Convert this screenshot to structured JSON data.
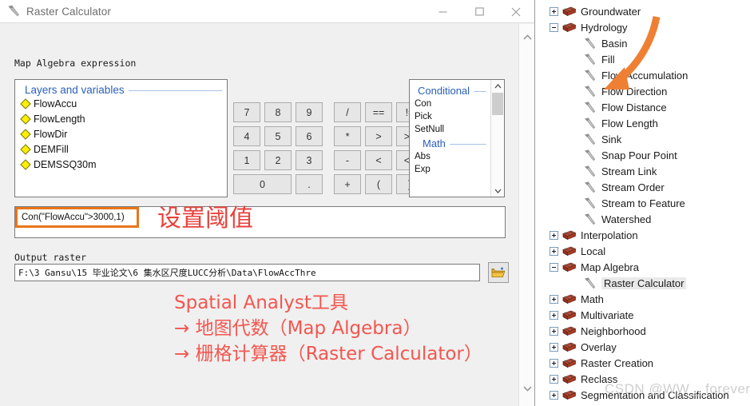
{
  "dialog": {
    "title": "Raster Calculator",
    "title_icon": "hammer-tool-icon",
    "window_buttons": {
      "minimize": "minimize-icon",
      "maximize": "maximize-icon",
      "close": "close-icon"
    },
    "expression_label": "Map Algebra expression",
    "layers_group": {
      "header": "Layers and variables",
      "items": [
        {
          "name": "FlowAccu",
          "icon": "raster-layer-diamond-icon"
        },
        {
          "name": "FlowLength",
          "icon": "raster-layer-diamond-icon"
        },
        {
          "name": "FlowDir",
          "icon": "raster-layer-diamond-icon"
        },
        {
          "name": "DEMFill",
          "icon": "raster-layer-diamond-icon"
        },
        {
          "name": "DEMSSQ30m",
          "icon": "raster-layer-diamond-icon"
        }
      ]
    },
    "keypad": {
      "rows": [
        [
          "7",
          "8",
          "9",
          "/",
          "==",
          "!=",
          "&"
        ],
        [
          "4",
          "5",
          "6",
          "*",
          ">",
          ">=",
          "|"
        ],
        [
          "1",
          "2",
          "3",
          "-",
          "<",
          "<=",
          "^"
        ],
        [
          "0",
          ".",
          "+",
          "(",
          ")",
          "~"
        ]
      ]
    },
    "functions": {
      "conditional_header": "Conditional",
      "conditional_items": [
        "Con",
        "Pick",
        "SetNull"
      ],
      "math_header": "Math",
      "math_items": [
        "Abs",
        "Exp"
      ]
    },
    "expression_value": "Con(\"FlowAccu\">3000,1)",
    "output_label": "Output raster",
    "output_value": "F:\\3 Gansu\\15 毕业论文\\6 集水区尺度LUCC分析\\Data\\FlowAccThre",
    "browse_icon": "open-folder-icon"
  },
  "annotations": {
    "threshold_note": "设置阈值",
    "highlight_color": "#e8761b",
    "note_color": "#f3564f",
    "arrow_color": "#ef8033",
    "path_lines": [
      "Spatial Analyst工具",
      "→ 地图代数（Map Algebra）",
      "→ 栅格计算器（Raster Calculator）"
    ]
  },
  "toolbox_tree": {
    "nodes": [
      {
        "label": "Groundwater",
        "type": "toolbox",
        "state": "collapsed",
        "indent": 0,
        "selected": false
      },
      {
        "label": "Hydrology",
        "type": "toolbox",
        "state": "expanded",
        "indent": 0,
        "selected": false
      },
      {
        "label": "Basin",
        "type": "tool",
        "state": "leaf",
        "indent": 1,
        "selected": false
      },
      {
        "label": "Fill",
        "type": "tool",
        "state": "leaf",
        "indent": 1,
        "selected": false
      },
      {
        "label": "Flow Accumulation",
        "type": "tool",
        "state": "leaf",
        "indent": 1,
        "selected": false
      },
      {
        "label": "Flow Direction",
        "type": "tool",
        "state": "leaf",
        "indent": 1,
        "selected": false
      },
      {
        "label": "Flow Distance",
        "type": "tool",
        "state": "leaf",
        "indent": 1,
        "selected": false
      },
      {
        "label": "Flow Length",
        "type": "tool",
        "state": "leaf",
        "indent": 1,
        "selected": false
      },
      {
        "label": "Sink",
        "type": "tool",
        "state": "leaf",
        "indent": 1,
        "selected": false
      },
      {
        "label": "Snap Pour Point",
        "type": "tool",
        "state": "leaf",
        "indent": 1,
        "selected": false
      },
      {
        "label": "Stream Link",
        "type": "tool",
        "state": "leaf",
        "indent": 1,
        "selected": false
      },
      {
        "label": "Stream Order",
        "type": "tool",
        "state": "leaf",
        "indent": 1,
        "selected": false
      },
      {
        "label": "Stream to Feature",
        "type": "tool",
        "state": "leaf",
        "indent": 1,
        "selected": false
      },
      {
        "label": "Watershed",
        "type": "tool",
        "state": "leaf",
        "indent": 1,
        "selected": false
      },
      {
        "label": "Interpolation",
        "type": "toolbox",
        "state": "collapsed",
        "indent": 0,
        "selected": false
      },
      {
        "label": "Local",
        "type": "toolbox",
        "state": "collapsed",
        "indent": 0,
        "selected": false
      },
      {
        "label": "Map Algebra",
        "type": "toolbox",
        "state": "expanded",
        "indent": 0,
        "selected": false
      },
      {
        "label": "Raster Calculator",
        "type": "tool",
        "state": "leaf",
        "indent": 1,
        "selected": true
      },
      {
        "label": "Math",
        "type": "toolbox",
        "state": "collapsed",
        "indent": 0,
        "selected": false
      },
      {
        "label": "Multivariate",
        "type": "toolbox",
        "state": "collapsed",
        "indent": 0,
        "selected": false
      },
      {
        "label": "Neighborhood",
        "type": "toolbox",
        "state": "collapsed",
        "indent": 0,
        "selected": false
      },
      {
        "label": "Overlay",
        "type": "toolbox",
        "state": "collapsed",
        "indent": 0,
        "selected": false
      },
      {
        "label": "Raster Creation",
        "type": "toolbox",
        "state": "collapsed",
        "indent": 0,
        "selected": false
      },
      {
        "label": "Reclass",
        "type": "toolbox",
        "state": "collapsed",
        "indent": 0,
        "selected": false
      },
      {
        "label": "Segmentation and Classification",
        "type": "toolbox",
        "state": "collapsed",
        "indent": 0,
        "selected": false
      }
    ]
  },
  "watermark": "CSDN @WW__forever"
}
